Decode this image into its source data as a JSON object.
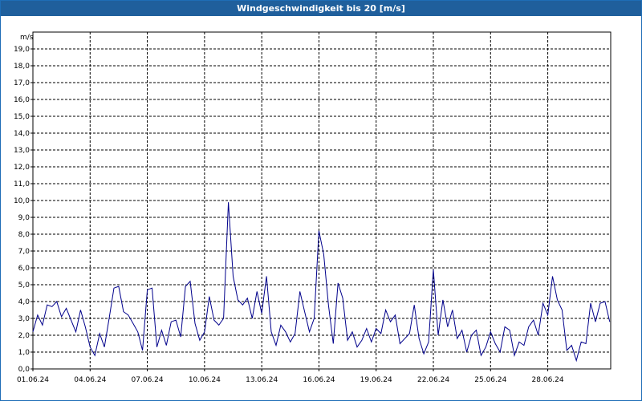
{
  "window": {
    "title": "Windgeschwindigkeit bis 20 [m/s]"
  },
  "chart_data": {
    "type": "line",
    "title": "Windgeschwindigkeit bis 20 [m/s]",
    "ylabel": "m/s",
    "xlabel": "",
    "ylim": [
      0,
      20
    ],
    "xlim_days": [
      0,
      30.3
    ],
    "y_ticks": [
      "0,0",
      "1,0",
      "2,0",
      "3,0",
      "4,0",
      "5,0",
      "6,0",
      "7,0",
      "8,0",
      "9,0",
      "10,0",
      "11,0",
      "12,0",
      "13,0",
      "14,0",
      "15,0",
      "16,0",
      "17,0",
      "18,0",
      "19,0"
    ],
    "x_ticks": [
      "01.06.24",
      "04.06.24",
      "07.06.24",
      "10.06.24",
      "13.06.24",
      "16.06.24",
      "19.06.24",
      "22.06.24",
      "25.06.24",
      "28.06.24"
    ],
    "grid": true,
    "line_color": "#00008b",
    "series": [
      {
        "x": [
          "01.06.24 00:00",
          "01.06.24 06:00",
          "01.06.24 12:00",
          "01.06.24 18:00",
          "02.06.24 00:00",
          "02.06.24 06:00",
          "02.06.24 12:00",
          "02.06.24 18:00",
          "03.06.24 00:00",
          "03.06.24 06:00",
          "03.06.24 12:00",
          "03.06.24 18:00",
          "04.06.24 00:00",
          "04.06.24 06:00",
          "04.06.24 12:00",
          "04.06.24 18:00",
          "05.06.24 00:00",
          "05.06.24 06:00",
          "05.06.24 12:00",
          "05.06.24 18:00",
          "06.06.24 00:00",
          "06.06.24 06:00",
          "06.06.24 12:00",
          "06.06.24 18:00",
          "07.06.24 00:00",
          "07.06.24 06:00",
          "07.06.24 12:00",
          "07.06.24 18:00",
          "08.06.24 00:00",
          "08.06.24 06:00",
          "08.06.24 12:00",
          "08.06.24 18:00",
          "09.06.24 00:00",
          "09.06.24 06:00",
          "09.06.24 12:00",
          "09.06.24 18:00",
          "10.06.24 00:00",
          "10.06.24 06:00",
          "10.06.24 12:00",
          "10.06.24 18:00",
          "11.06.24 00:00",
          "11.06.24 06:00",
          "11.06.24 12:00",
          "11.06.24 18:00",
          "12.06.24 00:00",
          "12.06.24 06:00",
          "12.06.24 12:00",
          "12.06.24 18:00",
          "13.06.24 00:00",
          "13.06.24 06:00",
          "13.06.24 12:00",
          "13.06.24 18:00",
          "14.06.24 00:00",
          "14.06.24 06:00",
          "14.06.24 12:00",
          "14.06.24 18:00",
          "15.06.24 00:00",
          "15.06.24 06:00",
          "15.06.24 12:00",
          "15.06.24 18:00",
          "16.06.24 00:00",
          "16.06.24 06:00",
          "16.06.24 12:00",
          "16.06.24 18:00",
          "17.06.24 00:00",
          "17.06.24 06:00",
          "17.06.24 12:00",
          "17.06.24 18:00",
          "18.06.24 00:00",
          "18.06.24 06:00",
          "18.06.24 12:00",
          "18.06.24 18:00",
          "19.06.24 00:00",
          "19.06.24 06:00",
          "19.06.24 12:00",
          "19.06.24 18:00",
          "20.06.24 00:00",
          "20.06.24 06:00",
          "20.06.24 12:00",
          "20.06.24 18:00",
          "21.06.24 00:00",
          "21.06.24 06:00",
          "21.06.24 12:00",
          "21.06.24 18:00",
          "22.06.24 00:00",
          "22.06.24 06:00",
          "22.06.24 12:00",
          "22.06.24 18:00",
          "23.06.24 00:00",
          "23.06.24 06:00",
          "23.06.24 12:00",
          "23.06.24 18:00",
          "24.06.24 00:00",
          "24.06.24 06:00",
          "24.06.24 12:00",
          "24.06.24 18:00",
          "25.06.24 00:00",
          "25.06.24 06:00",
          "25.06.24 12:00",
          "25.06.24 18:00",
          "26.06.24 00:00",
          "26.06.24 06:00",
          "26.06.24 12:00",
          "26.06.24 18:00",
          "27.06.24 00:00",
          "27.06.24 06:00",
          "27.06.24 12:00",
          "27.06.24 18:00",
          "28.06.24 00:00",
          "28.06.24 06:00",
          "28.06.24 12:00",
          "28.06.24 18:00",
          "29.06.24 00:00",
          "29.06.24 06:00",
          "29.06.24 12:00",
          "29.06.24 18:00",
          "30.06.24 00:00",
          "30.06.24 06:00",
          "30.06.24 12:00",
          "30.06.24 18:00",
          "01.07.24 00:00",
          "01.07.24 06:00"
        ],
        "values": [
          2.2,
          3.2,
          2.6,
          3.8,
          3.7,
          4.0,
          3.1,
          3.6,
          2.9,
          2.2,
          3.5,
          2.5,
          1.3,
          0.8,
          2.1,
          1.3,
          3.0,
          4.8,
          4.9,
          3.4,
          3.2,
          2.7,
          2.2,
          1.1,
          4.7,
          4.8,
          1.3,
          2.3,
          1.4,
          2.8,
          2.9,
          1.9,
          4.9,
          5.2,
          2.7,
          1.7,
          2.2,
          4.3,
          2.9,
          2.6,
          3.0,
          9.9,
          5.5,
          4.1,
          3.8,
          4.2,
          3.0,
          4.6,
          3.3,
          5.5,
          2.2,
          1.4,
          2.6,
          2.2,
          1.6,
          2.1,
          4.6,
          3.4,
          2.2,
          3.0,
          8.2,
          6.8,
          3.8,
          1.5,
          5.1,
          4.2,
          1.7,
          2.2,
          1.3,
          1.7,
          2.4,
          1.6,
          2.4,
          2.1,
          3.5,
          2.8,
          3.2,
          1.5,
          1.8,
          2.1,
          3.8,
          1.8,
          0.9,
          1.6,
          5.9,
          2.0,
          4.1,
          2.5,
          3.5,
          1.8,
          2.3,
          1.0,
          2.0,
          2.3,
          0.8,
          1.3,
          2.2,
          1.5,
          1.0,
          2.5,
          2.3,
          0.8,
          1.6,
          1.4,
          2.5,
          2.9,
          2.0,
          3.9,
          3.2,
          5.5,
          4.1,
          3.5,
          1.1,
          1.4,
          0.5,
          1.6,
          1.5,
          3.9,
          2.8,
          3.9,
          4.0,
          2.8
        ]
      }
    ]
  }
}
